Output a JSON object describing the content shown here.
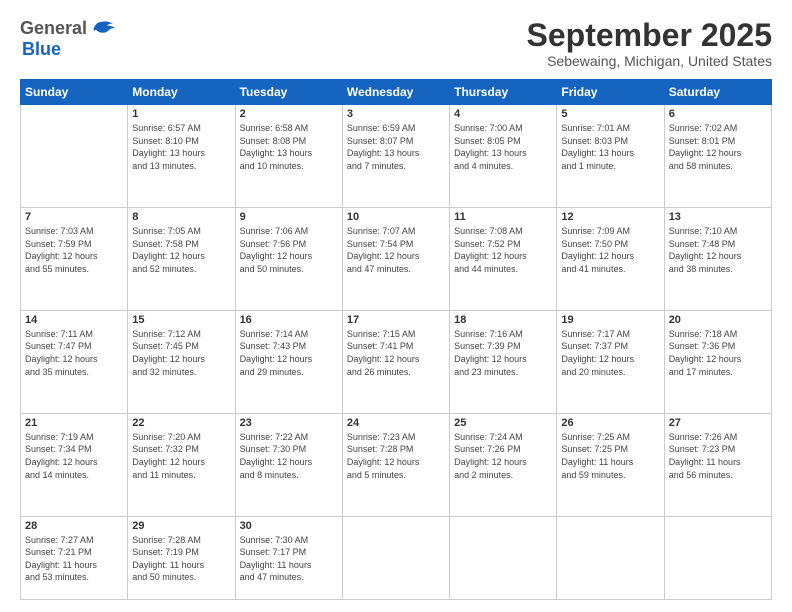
{
  "header": {
    "logo_general": "General",
    "logo_blue": "Blue",
    "month_title": "September 2025",
    "subtitle": "Sebewaing, Michigan, United States"
  },
  "days_of_week": [
    "Sunday",
    "Monday",
    "Tuesday",
    "Wednesday",
    "Thursday",
    "Friday",
    "Saturday"
  ],
  "weeks": [
    [
      {
        "day": "",
        "text": ""
      },
      {
        "day": "1",
        "text": "Sunrise: 6:57 AM\nSunset: 8:10 PM\nDaylight: 13 hours\nand 13 minutes."
      },
      {
        "day": "2",
        "text": "Sunrise: 6:58 AM\nSunset: 8:08 PM\nDaylight: 13 hours\nand 10 minutes."
      },
      {
        "day": "3",
        "text": "Sunrise: 6:59 AM\nSunset: 8:07 PM\nDaylight: 13 hours\nand 7 minutes."
      },
      {
        "day": "4",
        "text": "Sunrise: 7:00 AM\nSunset: 8:05 PM\nDaylight: 13 hours\nand 4 minutes."
      },
      {
        "day": "5",
        "text": "Sunrise: 7:01 AM\nSunset: 8:03 PM\nDaylight: 13 hours\nand 1 minute."
      },
      {
        "day": "6",
        "text": "Sunrise: 7:02 AM\nSunset: 8:01 PM\nDaylight: 12 hours\nand 58 minutes."
      }
    ],
    [
      {
        "day": "7",
        "text": "Sunrise: 7:03 AM\nSunset: 7:59 PM\nDaylight: 12 hours\nand 55 minutes."
      },
      {
        "day": "8",
        "text": "Sunrise: 7:05 AM\nSunset: 7:58 PM\nDaylight: 12 hours\nand 52 minutes."
      },
      {
        "day": "9",
        "text": "Sunrise: 7:06 AM\nSunset: 7:56 PM\nDaylight: 12 hours\nand 50 minutes."
      },
      {
        "day": "10",
        "text": "Sunrise: 7:07 AM\nSunset: 7:54 PM\nDaylight: 12 hours\nand 47 minutes."
      },
      {
        "day": "11",
        "text": "Sunrise: 7:08 AM\nSunset: 7:52 PM\nDaylight: 12 hours\nand 44 minutes."
      },
      {
        "day": "12",
        "text": "Sunrise: 7:09 AM\nSunset: 7:50 PM\nDaylight: 12 hours\nand 41 minutes."
      },
      {
        "day": "13",
        "text": "Sunrise: 7:10 AM\nSunset: 7:48 PM\nDaylight: 12 hours\nand 38 minutes."
      }
    ],
    [
      {
        "day": "14",
        "text": "Sunrise: 7:11 AM\nSunset: 7:47 PM\nDaylight: 12 hours\nand 35 minutes."
      },
      {
        "day": "15",
        "text": "Sunrise: 7:12 AM\nSunset: 7:45 PM\nDaylight: 12 hours\nand 32 minutes."
      },
      {
        "day": "16",
        "text": "Sunrise: 7:14 AM\nSunset: 7:43 PM\nDaylight: 12 hours\nand 29 minutes."
      },
      {
        "day": "17",
        "text": "Sunrise: 7:15 AM\nSunset: 7:41 PM\nDaylight: 12 hours\nand 26 minutes."
      },
      {
        "day": "18",
        "text": "Sunrise: 7:16 AM\nSunset: 7:39 PM\nDaylight: 12 hours\nand 23 minutes."
      },
      {
        "day": "19",
        "text": "Sunrise: 7:17 AM\nSunset: 7:37 PM\nDaylight: 12 hours\nand 20 minutes."
      },
      {
        "day": "20",
        "text": "Sunrise: 7:18 AM\nSunset: 7:36 PM\nDaylight: 12 hours\nand 17 minutes."
      }
    ],
    [
      {
        "day": "21",
        "text": "Sunrise: 7:19 AM\nSunset: 7:34 PM\nDaylight: 12 hours\nand 14 minutes."
      },
      {
        "day": "22",
        "text": "Sunrise: 7:20 AM\nSunset: 7:32 PM\nDaylight: 12 hours\nand 11 minutes."
      },
      {
        "day": "23",
        "text": "Sunrise: 7:22 AM\nSunset: 7:30 PM\nDaylight: 12 hours\nand 8 minutes."
      },
      {
        "day": "24",
        "text": "Sunrise: 7:23 AM\nSunset: 7:28 PM\nDaylight: 12 hours\nand 5 minutes."
      },
      {
        "day": "25",
        "text": "Sunrise: 7:24 AM\nSunset: 7:26 PM\nDaylight: 12 hours\nand 2 minutes."
      },
      {
        "day": "26",
        "text": "Sunrise: 7:25 AM\nSunset: 7:25 PM\nDaylight: 11 hours\nand 59 minutes."
      },
      {
        "day": "27",
        "text": "Sunrise: 7:26 AM\nSunset: 7:23 PM\nDaylight: 11 hours\nand 56 minutes."
      }
    ],
    [
      {
        "day": "28",
        "text": "Sunrise: 7:27 AM\nSunset: 7:21 PM\nDaylight: 11 hours\nand 53 minutes."
      },
      {
        "day": "29",
        "text": "Sunrise: 7:28 AM\nSunset: 7:19 PM\nDaylight: 11 hours\nand 50 minutes."
      },
      {
        "day": "30",
        "text": "Sunrise: 7:30 AM\nSunset: 7:17 PM\nDaylight: 11 hours\nand 47 minutes."
      },
      {
        "day": "",
        "text": ""
      },
      {
        "day": "",
        "text": ""
      },
      {
        "day": "",
        "text": ""
      },
      {
        "day": "",
        "text": ""
      }
    ]
  ]
}
